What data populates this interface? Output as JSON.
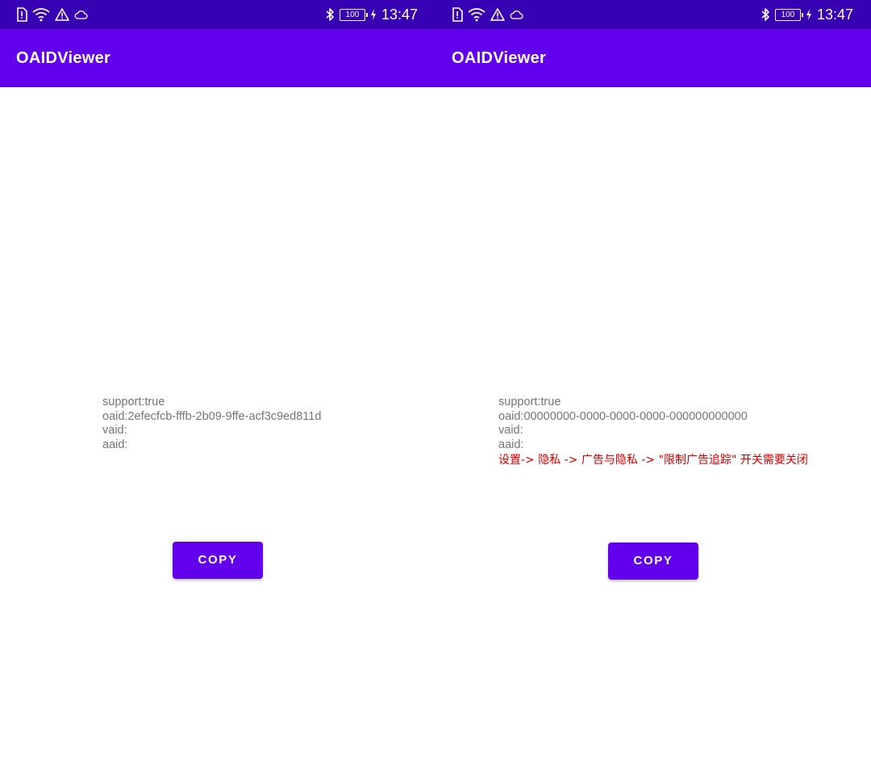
{
  "screens": [
    {
      "status_bar": {
        "left_icons": [
          "sim-alert-icon",
          "wifi-icon",
          "warning-icon",
          "cloud-icon"
        ],
        "right_icons": [
          "bluetooth-icon",
          "battery-icon",
          "charging-icon"
        ],
        "battery_level": "100",
        "time": "13:47"
      },
      "app_bar": {
        "title": "OAIDViewer"
      },
      "info": {
        "support": "support:true",
        "oaid": "oaid:2efecfcb-fffb-2b09-9ffe-acf3c9ed811d",
        "vaid": "vaid:",
        "aaid": "aaid:",
        "warning": ""
      },
      "copy_button": {
        "label": "COPY"
      }
    },
    {
      "status_bar": {
        "left_icons": [
          "sim-alert-icon",
          "wifi-icon",
          "warning-icon",
          "cloud-icon"
        ],
        "right_icons": [
          "bluetooth-icon",
          "battery-icon",
          "charging-icon"
        ],
        "battery_level": "100",
        "time": "13:47"
      },
      "app_bar": {
        "title": "OAIDViewer"
      },
      "info": {
        "support": "support:true",
        "oaid": "oaid:00000000-0000-0000-0000-000000000000",
        "vaid": "vaid:",
        "aaid": "aaid:",
        "warning": "设置-> 隐私 -> 广告与隐私 -> \"限制广告追踪\" 开关需要关闭"
      },
      "copy_button": {
        "label": "COPY"
      }
    }
  ],
  "colors": {
    "status_bar": "#3700b3",
    "app_bar": "#6200ee",
    "button": "#6200ee",
    "info_text": "#757575",
    "warning_text": "#d50000"
  }
}
